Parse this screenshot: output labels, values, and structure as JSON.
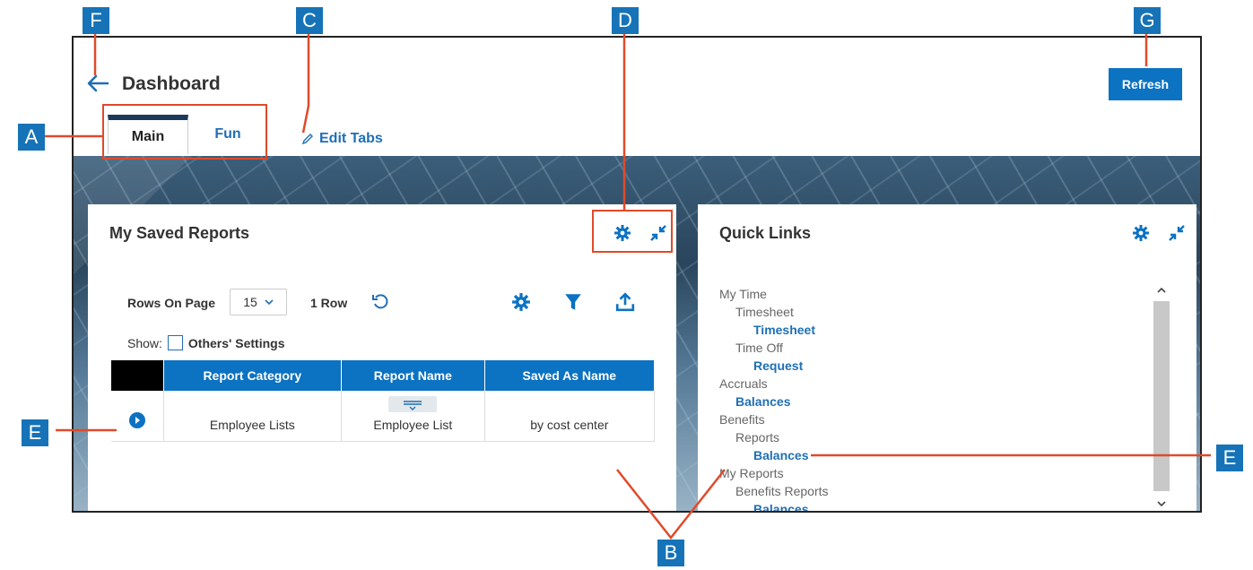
{
  "header": {
    "title": "Dashboard",
    "refresh_label": "Refresh",
    "edit_tabs_label": "Edit Tabs"
  },
  "tabs": [
    {
      "label": "Main",
      "active": true
    },
    {
      "label": "Fun",
      "active": false
    }
  ],
  "saved_reports": {
    "title": "My Saved Reports",
    "rows_on_page_label": "Rows On Page",
    "rows_on_page_value": "15",
    "row_count": "1 Row",
    "show_label": "Show:",
    "others_settings_label": "Others' Settings",
    "columns": [
      "Report Category",
      "Report Name",
      "Saved As Name"
    ],
    "rows": [
      {
        "category": "Employee Lists",
        "name": "Employee List",
        "saved_as": "by cost center"
      }
    ]
  },
  "quick_links": {
    "title": "Quick Links",
    "items": [
      {
        "text": "My Time",
        "level": "head"
      },
      {
        "text": "Timesheet",
        "level": "sub"
      },
      {
        "text": "Timesheet",
        "level": "link"
      },
      {
        "text": "Time Off",
        "level": "sub"
      },
      {
        "text": "Request",
        "level": "link"
      },
      {
        "text": "Accruals",
        "level": "head"
      },
      {
        "text": "Balances",
        "level": "link1"
      },
      {
        "text": "Benefits",
        "level": "head"
      },
      {
        "text": "Reports",
        "level": "sub"
      },
      {
        "text": "Balances",
        "level": "link"
      },
      {
        "text": "My Reports",
        "level": "head"
      },
      {
        "text": "Benefits Reports",
        "level": "sub"
      },
      {
        "text": "Balances",
        "level": "link"
      }
    ]
  },
  "callouts": [
    "A",
    "B",
    "C",
    "D",
    "E",
    "E",
    "F",
    "G"
  ],
  "colors": {
    "accent": "#0c72c2",
    "link": "#1f6fb5",
    "callout_box": "#1673b8",
    "callout_line": "#e04a2a",
    "tab_indicator": "#1b3a5c"
  },
  "icons": [
    "back-arrow-icon",
    "pencil-icon",
    "gear-icon",
    "collapse-icon",
    "undo-icon",
    "filter-icon",
    "export-icon",
    "chevron-down-icon",
    "play-icon",
    "drag-handle-icon",
    "scroll-up-icon",
    "scroll-down-icon"
  ]
}
